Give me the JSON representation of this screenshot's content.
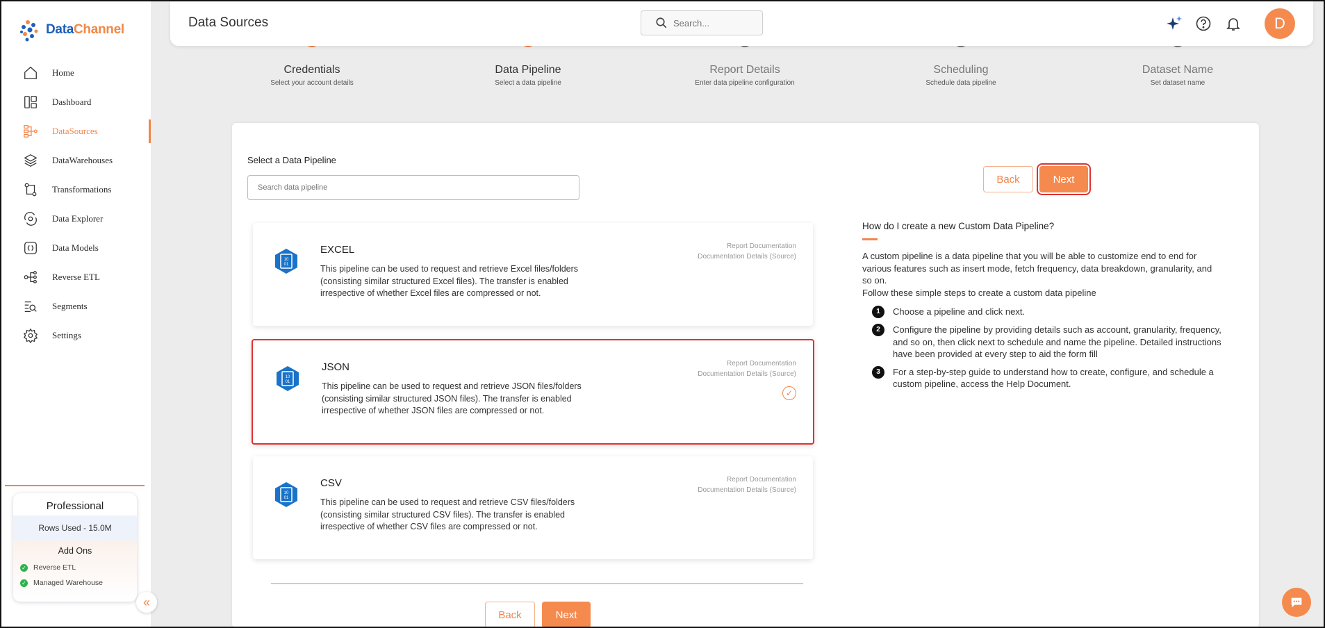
{
  "brand": {
    "part1": "Data",
    "part2": "Channel"
  },
  "sidebar": {
    "items": [
      {
        "label": "Home",
        "icon": "home-icon"
      },
      {
        "label": "Dashboard",
        "icon": "dashboard-icon"
      },
      {
        "label": "DataSources",
        "icon": "datasources-icon",
        "active": true
      },
      {
        "label": "DataWarehouses",
        "icon": "layers-icon"
      },
      {
        "label": "Transformations",
        "icon": "transform-icon"
      },
      {
        "label": "Data Explorer",
        "icon": "explorer-icon"
      },
      {
        "label": "Data Models",
        "icon": "models-icon"
      },
      {
        "label": "Reverse ETL",
        "icon": "reverse-etl-icon"
      },
      {
        "label": "Segments",
        "icon": "segments-icon"
      },
      {
        "label": "Settings",
        "icon": "gear-icon"
      }
    ],
    "plan": {
      "title": "Professional",
      "rows_used": "Rows Used - 15.0M",
      "addons_title": "Add Ons",
      "addons": [
        "Reverse ETL",
        "Managed Warehouse"
      ]
    }
  },
  "header": {
    "title": "Data Sources",
    "search_placeholder": "Search...",
    "avatar_initial": "D"
  },
  "steps": [
    {
      "title": "Credentials",
      "subtitle": "Select your account details",
      "state": "done"
    },
    {
      "title": "Data Pipeline",
      "subtitle": "Select a data pipeline",
      "state": "current"
    },
    {
      "title": "Report Details",
      "subtitle": "Enter data pipeline configuration",
      "state": "pending"
    },
    {
      "title": "Scheduling",
      "subtitle": "Schedule data pipeline",
      "state": "pending"
    },
    {
      "title": "Dataset Name",
      "subtitle": "Set dataset name",
      "state": "pending"
    }
  ],
  "content": {
    "select_label": "Select a Data Pipeline",
    "search_placeholder": "Search data pipeline",
    "back_label": "Back",
    "next_label": "Next",
    "pipelines": [
      {
        "name": "EXCEL",
        "description": "This pipeline can be used to request and retrieve Excel files/folders (consisting similar structured Excel files). The transfer is enabled irrespective of whether Excel files are compressed or not.",
        "doc1": "Report Documentation",
        "doc2": "Documentation Details (Source)"
      },
      {
        "name": "JSON",
        "description": "This pipeline can be used to request and retrieve JSON files/folders (consisting similar structured JSON files). The transfer is enabled irrespective of whether JSON files are compressed or not.",
        "doc1": "Report Documentation",
        "doc2": "Documentation Details (Source)",
        "selected": true
      },
      {
        "name": "CSV",
        "description": "This pipeline can be used to request and retrieve CSV files/folders (consisting similar structured CSV files). The transfer is enabled irrespective of whether CSV files are compressed or not.",
        "doc1": "Report Documentation",
        "doc2": "Documentation Details (Source)"
      }
    ]
  },
  "help": {
    "title": "How do I create a new Custom Data Pipeline?",
    "intro": "A custom pipeline is a data pipeline that you will be able to customize end to end for various features such as insert mode, fetch frequency, data breakdown, granularity, and so on.",
    "follow": "Follow these simple steps to create a custom data pipeline",
    "steps": [
      "Choose a pipeline and click next.",
      "Configure the pipeline by providing details such as account, granularity, frequency, and so on, then click next to schedule and name the pipeline. Detailed instructions have been provided at every step to aid the form fill",
      "For a step-by-step guide to understand how to create, configure, and schedule a custom pipeline, access the Help Document."
    ]
  },
  "colors": {
    "accent": "#f58a4f",
    "highlight": "#dd3333",
    "brand_blue": "#1f5fb8"
  }
}
